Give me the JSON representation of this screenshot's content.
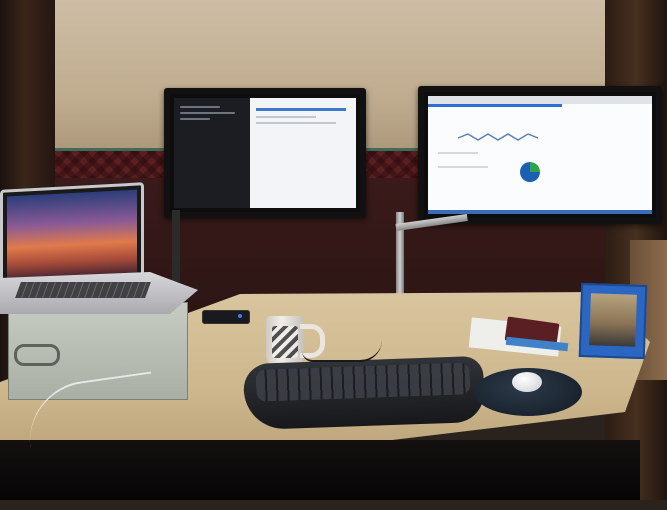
{
  "scene": {
    "description_type": "photo",
    "colors": {
      "wall": "#c0ad90",
      "wallpaper_border": "#5b1f22",
      "desk": "#cdb68c",
      "monitor_bezel": "#111111",
      "accent_blue": "#2f6fd0",
      "pie_green": "#2fa34a",
      "pie_blue": "#1b5fb3"
    },
    "icons": [
      "laptop",
      "monitor-left",
      "monitor-right",
      "coffee-mug",
      "keyboard",
      "mouse",
      "photo-frame",
      "usb-hub",
      "metal-box"
    ]
  }
}
